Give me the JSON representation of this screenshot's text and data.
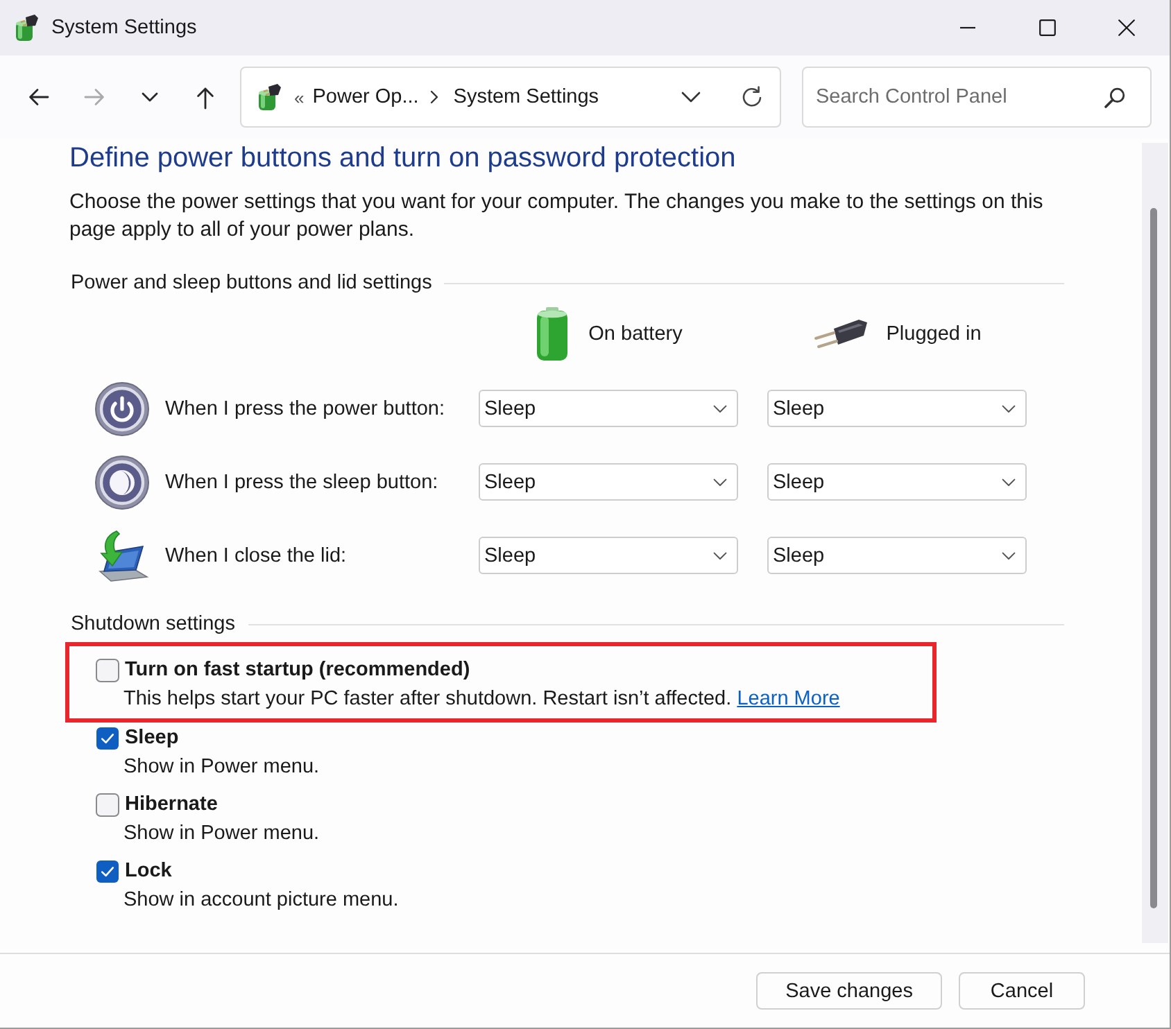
{
  "window": {
    "title": "System Settings"
  },
  "navigation": {
    "buttons": [
      {
        "kind": "back",
        "disabled": false
      },
      {
        "kind": "forward",
        "disabled": true
      },
      {
        "kind": "recent",
        "disabled": false
      },
      {
        "kind": "up",
        "disabled": false
      }
    ]
  },
  "address_bar": {
    "overflow": "«",
    "path": [
      "Power Op...",
      "System Settings"
    ]
  },
  "search": {
    "placeholder": "Search Control Panel"
  },
  "heading": "Define power buttons and turn on password protection",
  "intro": "Choose the power settings that you want for your computer. The changes you make to the settings on this page apply to all of your power plans.",
  "power_buttons": {
    "title": "Power and sleep buttons and lid settings",
    "columns": [
      {
        "kind": "battery",
        "label": "On battery"
      },
      {
        "kind": "plugged",
        "label": "Plugged in"
      }
    ],
    "rows": [
      {
        "kind": "power",
        "label": "When I press the power button:",
        "values": [
          "Sleep",
          "Sleep"
        ]
      },
      {
        "kind": "sleep",
        "label": "When I press the sleep button:",
        "values": [
          "Sleep",
          "Sleep"
        ]
      },
      {
        "kind": "lid",
        "label": "When I close the lid:",
        "values": [
          "Sleep",
          "Sleep"
        ]
      }
    ]
  },
  "shutdown": {
    "title": "Shutdown settings",
    "options": [
      {
        "label": "Turn on fast startup (recommended)",
        "description": "This helps start your PC faster after shutdown. Restart isn’t affected.",
        "link": "Learn More",
        "checked": false,
        "highlighted": true
      },
      {
        "label": "Sleep",
        "description": "Show in Power menu.",
        "checked": true,
        "highlighted": false
      },
      {
        "label": "Hibernate",
        "description": "Show in Power menu.",
        "checked": false,
        "highlighted": false
      },
      {
        "label": "Lock",
        "description": "Show in account picture menu.",
        "checked": true,
        "highlighted": false
      }
    ]
  },
  "buttons": [
    "Save changes",
    "Cancel"
  ]
}
